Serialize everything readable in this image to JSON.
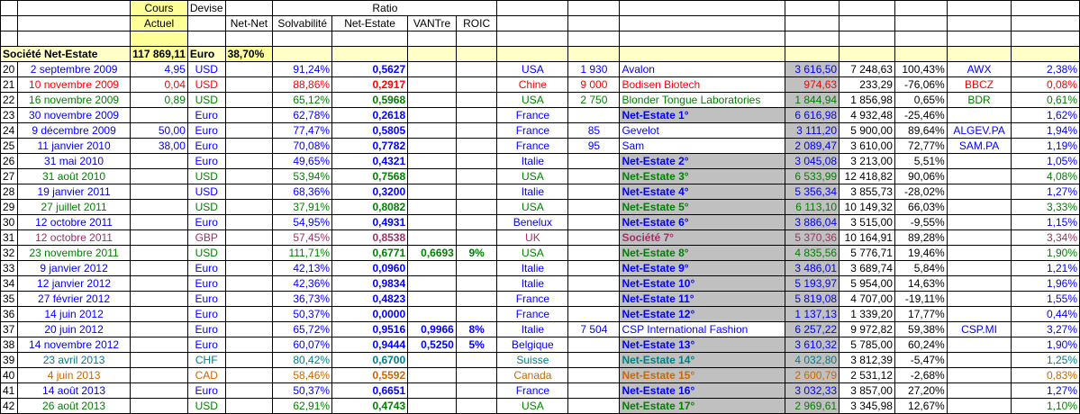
{
  "header": {
    "cours": "Cours",
    "actuel": "Actuel",
    "devise": "Devise",
    "ratio": "Ratio",
    "netnet": "Net-Net",
    "solv": "Solvabilité",
    "netestate": "Net-Estate",
    "vantre": "VANTre",
    "roic": "ROIC"
  },
  "societe": {
    "name": "Société Net-Estate",
    "value": "117 869,11",
    "currency": "Euro",
    "pct": "38,70%"
  },
  "colors": {
    "blue": "#0000ff",
    "green": "#008000",
    "red": "#ff0000",
    "teal": "#008080",
    "orange": "#cc6600",
    "brown": "#993366",
    "highlight": "#c0c0c0",
    "yellow": "#ffff99"
  },
  "rows": [
    {
      "n": "20",
      "date": "2 septembre 2009",
      "cours": "4,95",
      "devise": "USD",
      "netnet": "",
      "solv": "91,24%",
      "ne": "0,5627",
      "vant": "",
      "roic": "",
      "pays": "USA",
      "qty": "1 930",
      "name": "Avalon",
      "v1": "3 616,50",
      "v2": "7 248,63",
      "pct": "100,43%",
      "tick": "AWX",
      "last": "2,38%",
      "color": "blue",
      "hl": false,
      "nb": false
    },
    {
      "n": "21",
      "date": "10 novembre 2009",
      "cours": "0,04",
      "devise": "USD",
      "netnet": "",
      "solv": "88,86%",
      "ne": "0,2917",
      "vant": "",
      "roic": "",
      "pays": "Chine",
      "qty": "9 000",
      "name": "Bodisen Biotech",
      "v1": "974,63",
      "v2": "233,29",
      "pct": "-76,06%",
      "tick": "BBCZ",
      "last": "0,08%",
      "color": "red",
      "hl": false,
      "nb": false
    },
    {
      "n": "22",
      "date": "16 novembre 2009",
      "cours": "0,89",
      "devise": "USD",
      "netnet": "",
      "solv": "65,12%",
      "ne": "0,5968",
      "vant": "",
      "roic": "",
      "pays": "USA",
      "qty": "2 750",
      "name": "Blonder Tongue Laboratories",
      "v1": "1 844,94",
      "v2": "1 856,98",
      "pct": "0,65%",
      "tick": "BDR",
      "last": "0,61%",
      "color": "green",
      "hl": false,
      "nb": false
    },
    {
      "n": "23",
      "date": "30 novembre 2009",
      "cours": "",
      "devise": "Euro",
      "netnet": "",
      "solv": "62,78%",
      "ne": "0,2618",
      "vant": "",
      "roic": "",
      "pays": "France",
      "qty": "",
      "name": "Net-Estate 1°",
      "v1": "6 616,98",
      "v2": "4 932,48",
      "pct": "-25,46%",
      "tick": "",
      "last": "1,62%",
      "color": "blue",
      "hl": true,
      "nb": true
    },
    {
      "n": "24",
      "date": "9 décembre 2009",
      "cours": "50,00",
      "devise": "Euro",
      "netnet": "",
      "solv": "77,47%",
      "ne": "0,5805",
      "vant": "",
      "roic": "",
      "pays": "France",
      "qty": "85",
      "name": "Gevelot",
      "v1": "3 111,20",
      "v2": "5 900,00",
      "pct": "89,64%",
      "tick": "ALGEV.PA",
      "last": "1,94%",
      "color": "blue",
      "hl": false,
      "nb": false
    },
    {
      "n": "25",
      "date": "11 janvier 2010",
      "cours": "38,00",
      "devise": "Euro",
      "netnet": "",
      "solv": "70,08%",
      "ne": "0,7782",
      "vant": "",
      "roic": "",
      "pays": "France",
      "qty": "95",
      "name": "Sam",
      "v1": "2 089,47",
      "v2": "3 610,00",
      "pct": "72,77%",
      "tick": "SAM.PA",
      "last": "1,19%",
      "color": "blue",
      "hl": false,
      "nb": false
    },
    {
      "n": "26",
      "date": "31 mai 2010",
      "cours": "",
      "devise": "Euro",
      "netnet": "",
      "solv": "49,65%",
      "ne": "0,4321",
      "vant": "",
      "roic": "",
      "pays": "Italie",
      "qty": "",
      "name": "Net-Estate 2°",
      "v1": "3 045,08",
      "v2": "3 213,00",
      "pct": "5,51%",
      "tick": "",
      "last": "1,05%",
      "color": "blue",
      "hl": true,
      "nb": true
    },
    {
      "n": "27",
      "date": "31 août 2010",
      "cours": "",
      "devise": "USD",
      "netnet": "",
      "solv": "53,94%",
      "ne": "0,7568",
      "vant": "",
      "roic": "",
      "pays": "USA",
      "qty": "",
      "name": "Net-Estate 3°",
      "v1": "6 533,99",
      "v2": "12 418,82",
      "pct": "90,06%",
      "tick": "",
      "last": "4,08%",
      "color": "green",
      "hl": true,
      "nb": true
    },
    {
      "n": "28",
      "date": "19 janvier 2011",
      "cours": "",
      "devise": "USD",
      "netnet": "",
      "solv": "68,36%",
      "ne": "0,3200",
      "vant": "",
      "roic": "",
      "pays": "Italie",
      "qty": "",
      "name": "Net-Estate 4°",
      "v1": "5 356,34",
      "v2": "3 855,73",
      "pct": "-28,02%",
      "tick": "",
      "last": "1,27%",
      "color": "blue",
      "hl": true,
      "nb": true
    },
    {
      "n": "29",
      "date": "27 juillet 2011",
      "cours": "",
      "devise": "USD",
      "netnet": "",
      "solv": "37,91%",
      "ne": "0,8082",
      "vant": "",
      "roic": "",
      "pays": "USA",
      "qty": "",
      "name": "Net-Estate 5°",
      "v1": "6 113,10",
      "v2": "10 149,32",
      "pct": "66,03%",
      "tick": "",
      "last": "3,33%",
      "color": "green",
      "hl": true,
      "nb": true
    },
    {
      "n": "30",
      "date": "12 octobre 2011",
      "cours": "",
      "devise": "Euro",
      "netnet": "",
      "solv": "54,95%",
      "ne": "0,4931",
      "vant": "",
      "roic": "",
      "pays": "Benelux",
      "qty": "",
      "name": "Net-Estate 6°",
      "v1": "3 886,04",
      "v2": "3 515,00",
      "pct": "-9,55%",
      "tick": "",
      "last": "1,15%",
      "color": "blue",
      "hl": true,
      "nb": true
    },
    {
      "n": "31",
      "date": "12 octobre 2011",
      "cours": "",
      "devise": "GBP",
      "netnet": "",
      "solv": "57,45%",
      "ne": "0,8538",
      "vant": "",
      "roic": "",
      "pays": "UK",
      "qty": "",
      "name": "Société 7°",
      "v1": "5 370,36",
      "v2": "10 164,91",
      "pct": "89,28%",
      "tick": "",
      "last": "3,34%",
      "color": "brown",
      "hl": true,
      "nb": true
    },
    {
      "n": "32",
      "date": "23 novembre 2011",
      "cours": "",
      "devise": "USD",
      "netnet": "",
      "solv": "111,71%",
      "ne": "0,6771",
      "vant": "0,6693",
      "roic": "9%",
      "pays": "USA",
      "qty": "",
      "name": "Net-Estate 8°",
      "v1": "4 835,56",
      "v2": "5 776,71",
      "pct": "19,46%",
      "tick": "",
      "last": "1,90%",
      "color": "green",
      "hl": true,
      "nb": true
    },
    {
      "n": "33",
      "date": "9 janvier 2012",
      "cours": "",
      "devise": "Euro",
      "netnet": "",
      "solv": "42,13%",
      "ne": "0,0960",
      "vant": "",
      "roic": "",
      "pays": "Italie",
      "qty": "",
      "name": "Net-Estate 9°",
      "v1": "3 486,01",
      "v2": "3 689,74",
      "pct": "5,84%",
      "tick": "",
      "last": "1,21%",
      "color": "blue",
      "hl": true,
      "nb": true
    },
    {
      "n": "34",
      "date": "12 janvier 2012",
      "cours": "",
      "devise": "Euro",
      "netnet": "",
      "solv": "42,36%",
      "ne": "0,9834",
      "vant": "",
      "roic": "",
      "pays": "Italie",
      "qty": "",
      "name": "Net-Estate 10°",
      "v1": "5 193,97",
      "v2": "5 954,00",
      "pct": "14,63%",
      "tick": "",
      "last": "1,96%",
      "color": "blue",
      "hl": true,
      "nb": true
    },
    {
      "n": "35",
      "date": "27 février 2012",
      "cours": "",
      "devise": "Euro",
      "netnet": "",
      "solv": "36,73%",
      "ne": "0,4823",
      "vant": "",
      "roic": "",
      "pays": "France",
      "qty": "",
      "name": "Net-Estate 11°",
      "v1": "5 819,08",
      "v2": "4 707,00",
      "pct": "-19,11%",
      "tick": "",
      "last": "1,55%",
      "color": "blue",
      "hl": true,
      "nb": true
    },
    {
      "n": "36",
      "date": "14 juin 2012",
      "cours": "",
      "devise": "Euro",
      "netnet": "",
      "solv": "50,37%",
      "ne": "0,0000",
      "vant": "",
      "roic": "",
      "pays": "France",
      "qty": "",
      "name": "Net-Estate 12°",
      "v1": "1 137,13",
      "v2": "1 339,20",
      "pct": "17,77%",
      "tick": "",
      "last": "0,44%",
      "color": "blue",
      "hl": true,
      "nb": true
    },
    {
      "n": "37",
      "date": "20 juin 2012",
      "cours": "",
      "devise": "Euro",
      "netnet": "",
      "solv": "65,72%",
      "ne": "0,9516",
      "vant": "0,9966",
      "roic": "8%",
      "pays": "Italie",
      "qty": "7 504",
      "name": "CSP International Fashion",
      "v1": "6 257,22",
      "v2": "9 972,82",
      "pct": "59,38%",
      "tick": "CSP.MI",
      "last": "3,27%",
      "color": "blue",
      "hl": false,
      "nb": false
    },
    {
      "n": "38",
      "date": "14 novembre 2012",
      "cours": "",
      "devise": "Euro",
      "netnet": "",
      "solv": "60,07%",
      "ne": "0,9444",
      "vant": "0,5250",
      "roic": "5%",
      "pays": "Belgique",
      "qty": "",
      "name": "Net-Estate 13°",
      "v1": "3 610,32",
      "v2": "5 785,00",
      "pct": "60,24%",
      "tick": "",
      "last": "1,90%",
      "color": "blue",
      "hl": true,
      "nb": true
    },
    {
      "n": "39",
      "date": "23 avril 2013",
      "cours": "",
      "devise": "CHF",
      "netnet": "",
      "solv": "80,42%",
      "ne": "0,6700",
      "vant": "",
      "roic": "",
      "pays": "Suisse",
      "qty": "",
      "name": "Net-Estate 14°",
      "v1": "4 032,80",
      "v2": "3 812,39",
      "pct": "-5,47%",
      "tick": "",
      "last": "1,25%",
      "color": "teal",
      "hl": true,
      "nb": true
    },
    {
      "n": "40",
      "date": "4 juin 2013",
      "cours": "",
      "devise": "CAD",
      "netnet": "",
      "solv": "58,46%",
      "ne": "0,5592",
      "vant": "",
      "roic": "",
      "pays": "Canada",
      "qty": "",
      "name": "Net-Estate 15°",
      "v1": "2 600,79",
      "v2": "2 531,12",
      "pct": "-2,68%",
      "tick": "",
      "last": "0,83%",
      "color": "orange",
      "hl": true,
      "nb": true
    },
    {
      "n": "41",
      "date": "14 août 2013",
      "cours": "",
      "devise": "Euro",
      "netnet": "",
      "solv": "50,37%",
      "ne": "0,6651",
      "vant": "",
      "roic": "",
      "pays": "France",
      "qty": "",
      "name": "Net-Estate 16°",
      "v1": "3 032,33",
      "v2": "3 857,00",
      "pct": "27,20%",
      "tick": "",
      "last": "1,27%",
      "color": "blue",
      "hl": true,
      "nb": true
    },
    {
      "n": "42",
      "date": "26 août 2013",
      "cours": "",
      "devise": "USD",
      "netnet": "",
      "solv": "62,91%",
      "ne": "0,4743",
      "vant": "",
      "roic": "",
      "pays": "USA",
      "qty": "",
      "name": "Net-Estate 17°",
      "v1": "2 969,61",
      "v2": "3 345,98",
      "pct": "12,67%",
      "tick": "",
      "last": "1,10%",
      "color": "green",
      "hl": true,
      "nb": true
    }
  ]
}
